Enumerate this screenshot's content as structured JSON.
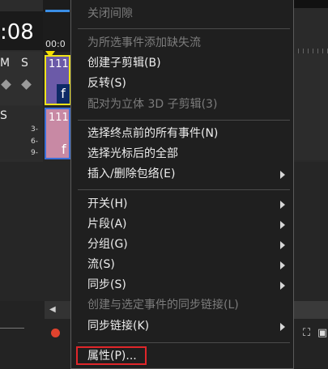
{
  "editor": {
    "timecode": ":08",
    "ruler_text": "00:0",
    "track1": {
      "mute_label": "M",
      "solo_label": "S",
      "clip_label": "111",
      "clip_thumb": "f"
    },
    "track2": {
      "solo_label": "S",
      "clip_label": "111",
      "clip_text": "f",
      "volume_marks": [
        "3-",
        "6-",
        "9-"
      ]
    }
  },
  "context_menu": {
    "items": [
      {
        "label": "关闭间隙",
        "enabled": false,
        "submenu": false
      },
      {
        "label": "为所选事件添加缺失流",
        "enabled": false,
        "submenu": false
      },
      {
        "label": "创建子剪辑(B)",
        "enabled": true,
        "submenu": false
      },
      {
        "label": "反转(S)",
        "enabled": true,
        "submenu": false
      },
      {
        "label": "配对为立体 3D 子剪辑(3)",
        "enabled": false,
        "submenu": false
      },
      {
        "label": "选择终点前的所有事件(N)",
        "enabled": true,
        "submenu": false
      },
      {
        "label": "选择光标后的全部",
        "enabled": true,
        "submenu": false
      },
      {
        "label": "插入/删除包络(E)",
        "enabled": true,
        "submenu": true
      },
      {
        "label": "开关(H)",
        "enabled": true,
        "submenu": true
      },
      {
        "label": "片段(A)",
        "enabled": true,
        "submenu": true
      },
      {
        "label": "分组(G)",
        "enabled": true,
        "submenu": true
      },
      {
        "label": "流(S)",
        "enabled": true,
        "submenu": true
      },
      {
        "label": "同步(S)",
        "enabled": true,
        "submenu": true
      },
      {
        "label": "创建与选定事件的同步链接(L)",
        "enabled": false,
        "submenu": false
      },
      {
        "label": "同步链接(K)",
        "enabled": true,
        "submenu": true
      },
      {
        "label": "属性(P)...",
        "enabled": true,
        "submenu": false,
        "highlighted": true
      }
    ]
  },
  "colors": {
    "menu_bg": "#1f1f1f",
    "menu_text": "#ececec",
    "menu_disabled_text": "#7c7c7c",
    "highlight_border": "#e0262a",
    "clip1": "#6b5aa8",
    "clip2": "#c889a4"
  }
}
